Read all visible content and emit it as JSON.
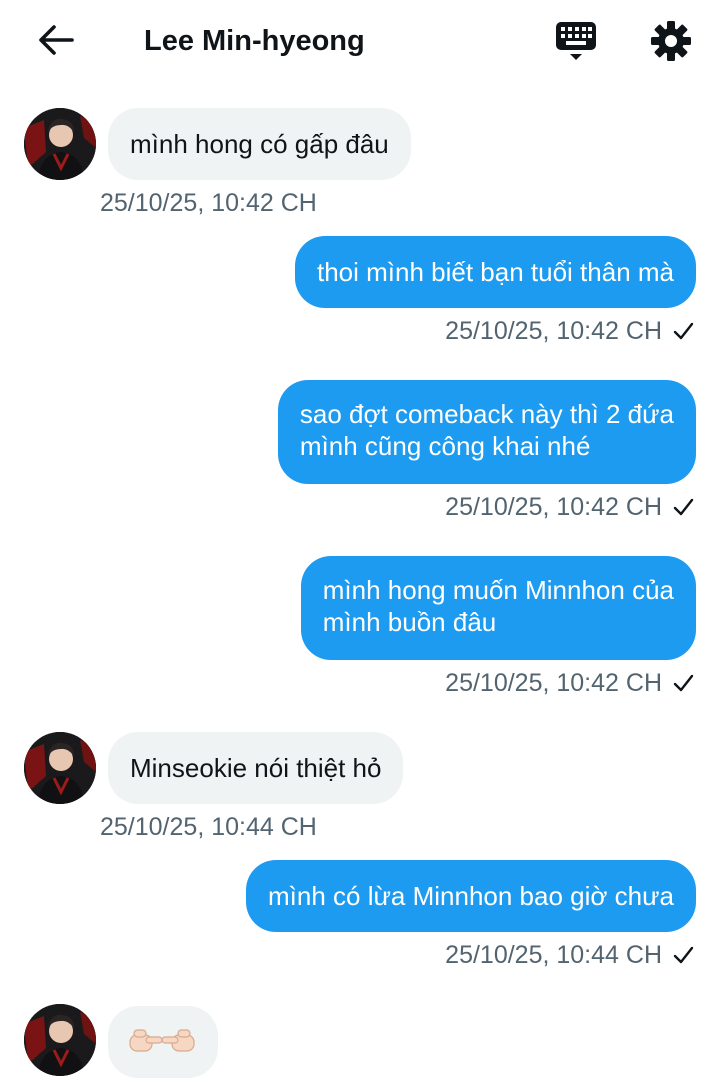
{
  "header": {
    "title": "Lee Min-hyeong",
    "back_icon": "arrow-left-icon",
    "keyboard_icon": "keyboard-icon",
    "settings_icon": "gear-icon"
  },
  "colors": {
    "outgoing_bubble": "#1d9bf0",
    "incoming_bubble": "#eff3f4",
    "timestamp": "#536471"
  },
  "messages": [
    {
      "direction": "incoming",
      "text": "mình hong có gấp đâu",
      "time": "25/10/25, 10:42 CH"
    },
    {
      "direction": "outgoing",
      "text": "thoi mình biết bạn tuổi thân mà",
      "time": "25/10/25, 10:42 CH"
    },
    {
      "direction": "outgoing",
      "text": "sao đợt comeback này thì 2 đứa\nmình cũng công khai nhé",
      "time": "25/10/25, 10:42 CH"
    },
    {
      "direction": "outgoing",
      "text": "mình hong muốn Minnhon của\nmình buồn đâu",
      "time": "25/10/25, 10:42 CH"
    },
    {
      "direction": "incoming",
      "text": "Minseokie nói thiệt hỏ",
      "time": "25/10/25, 10:44 CH"
    },
    {
      "direction": "outgoing",
      "text": "mình có lừa Minnhon bao giờ chưa",
      "time": "25/10/25, 10:44 CH"
    },
    {
      "direction": "incoming",
      "text": "👉🏻👈🏻",
      "time": ""
    }
  ]
}
